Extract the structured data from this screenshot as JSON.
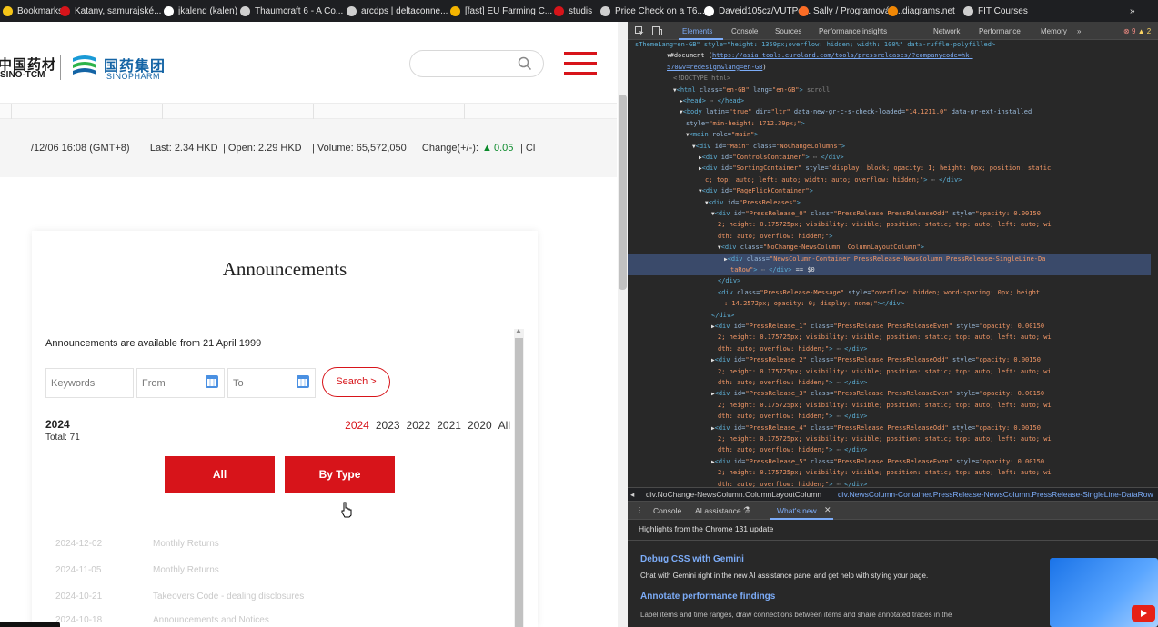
{
  "bookmarks": [
    {
      "label": "Bookmarks",
      "color": "#f5c518"
    },
    {
      "label": "Katany, samurajské...",
      "color": "#d7141a"
    },
    {
      "label": "jkalend (kalen)",
      "color": "#ffffff"
    },
    {
      "label": "Thaumcraft 6 - A Co...",
      "color": "#cfcfcf"
    },
    {
      "label": "arcdps | deltaconne...",
      "color": "#cfcfcf"
    },
    {
      "label": "[fast] EU Farming C...",
      "color": "#f4b400"
    },
    {
      "label": "studis",
      "color": "#d7141a"
    },
    {
      "label": "Price Check on a T6...",
      "color": "#cfcfcf"
    },
    {
      "label": "Daveid105cz/VUTPo...",
      "color": "#ffffff"
    },
    {
      "label": "Sally / Programován...",
      "color": "#fc6d26"
    },
    {
      "label": "diagrams.net",
      "color": "#f08705"
    },
    {
      "label": "FIT Courses",
      "color": "#cfcfcf"
    },
    {
      "label": "»",
      "color": ""
    }
  ],
  "header": {
    "logo_cn": "中国药材",
    "logo_en": "SINO-TCM",
    "sinopharm_cn": "国药集团",
    "sinopharm_en": "SINOPHARM"
  },
  "quote": {
    "date": "/12/06 16:08 (GMT+8)",
    "last": "| Last: 2.34 HKD",
    "open": "| Open: 2.29 HKD",
    "volume": "| Volume: 65,572,050",
    "change_label": "| Change(+/-):",
    "change_value": "0.05",
    "tail": "| Cl"
  },
  "announcements": {
    "title": "Announcements",
    "available": "Announcements are available from 21 April 1999",
    "keywords_placeholder": "Keywords",
    "from_placeholder": "From",
    "to_placeholder": "To",
    "search_label": "Search >",
    "selected_year": "2024",
    "total": "Total: 71",
    "years": [
      "2024",
      "2023",
      "2022",
      "2021",
      "2020",
      "All"
    ],
    "all_button": "All",
    "bytype_button": "By Type",
    "rows": [
      {
        "date": "2024-12-02",
        "title": "Monthly Returns"
      },
      {
        "date": "2024-11-05",
        "title": "Monthly Returns"
      },
      {
        "date": "2024-10-21",
        "title": "Takeovers Code - dealing disclosures"
      },
      {
        "date": "2024-10-18",
        "title": "Announcements and Notices"
      }
    ]
  },
  "devtools": {
    "tabs": [
      "Elements",
      "Console",
      "Sources",
      "Performance insights",
      "Network",
      "Performance",
      "Memory",
      "»"
    ],
    "errors": "9",
    "warnings": "2",
    "lines": [
      {
        "i": 0,
        "h": "",
        "frag": [
          [
            "tg",
            "sThemeLang=en-GB\" style=\"height: 1359px;overflow: hidden; width: 100%\" data-ruffle-polyfilled>"
          ]
        ]
      },
      {
        "i": 5,
        "h": "▼",
        "frag": [
          [
            "tx",
            "#document ("
          ],
          [
            "lk",
            "https://asia.tools.euroland.com/tools/pressreleases/?companycode=hk-"
          ]
        ]
      },
      {
        "i": 5,
        "h": "",
        "frag": [
          [
            "lk",
            "570&v=redesign&lang=en-GB"
          ],
          [
            "tx",
            ")"
          ]
        ]
      },
      {
        "i": 6,
        "h": "",
        "frag": [
          [
            "cm",
            "<!DOCTYPE html>"
          ]
        ]
      },
      {
        "i": 6,
        "h": "▼",
        "frag": [
          [
            "tg",
            "<html "
          ],
          [
            "at",
            "class="
          ],
          [
            "av",
            "\"en-GB\" "
          ],
          [
            "at",
            "lang="
          ],
          [
            "av",
            "\"en-GB\""
          ],
          [
            "tg",
            ">"
          ],
          [
            "cm",
            " scroll"
          ]
        ]
      },
      {
        "i": 7,
        "h": "▶",
        "frag": [
          [
            "tg",
            "<head>"
          ],
          [
            "cm",
            " ⋯ "
          ],
          [
            "tg",
            "</head>"
          ]
        ]
      },
      {
        "i": 7,
        "h": "▼",
        "frag": [
          [
            "tg",
            "<body "
          ],
          [
            "at",
            "latin="
          ],
          [
            "av",
            "\"true\" "
          ],
          [
            "at",
            "dir="
          ],
          [
            "av",
            "\"ltr\" "
          ],
          [
            "at",
            "data-new-gr-c-s-check-loaded="
          ],
          [
            "av",
            "\"14.1211.0\" "
          ],
          [
            "at",
            "data-gr-ext-installed"
          ]
        ]
      },
      {
        "i": 8,
        "h": "",
        "frag": [
          [
            "at",
            "style="
          ],
          [
            "av",
            "\"min-height: 1712.39px;\""
          ],
          [
            "tg",
            ">"
          ]
        ]
      },
      {
        "i": 8,
        "h": "▼",
        "frag": [
          [
            "tg",
            "<main "
          ],
          [
            "at",
            "role="
          ],
          [
            "av",
            "\"main\""
          ],
          [
            "tg",
            ">"
          ]
        ]
      },
      {
        "i": 9,
        "h": "▼",
        "frag": [
          [
            "tg",
            "<div "
          ],
          [
            "at",
            "id="
          ],
          [
            "av",
            "\"Main\" "
          ],
          [
            "at",
            "class="
          ],
          [
            "av",
            "\"NoChangeColumns\""
          ],
          [
            "tg",
            ">"
          ]
        ]
      },
      {
        "i": 10,
        "h": "▶",
        "frag": [
          [
            "tg",
            "<div "
          ],
          [
            "at",
            "id="
          ],
          [
            "av",
            "\"ControlsContainer\""
          ],
          [
            "tg",
            ">"
          ],
          [
            "cm",
            " ⋯ "
          ],
          [
            "tg",
            "</div>"
          ]
        ]
      },
      {
        "i": 10,
        "h": "▶",
        "frag": [
          [
            "tg",
            "<div "
          ],
          [
            "at",
            "id="
          ],
          [
            "av",
            "\"SortingContainer\" "
          ],
          [
            "at",
            "style="
          ],
          [
            "av",
            "\"display: block; opacity: 1; height: 0px; position: static"
          ]
        ]
      },
      {
        "i": 11,
        "h": "",
        "frag": [
          [
            "av",
            "c; top: auto; left: auto; width: auto; overflow: hidden;\""
          ],
          [
            "tg",
            ">"
          ],
          [
            "cm",
            " ⋯ "
          ],
          [
            "tg",
            "</div>"
          ]
        ]
      },
      {
        "i": 10,
        "h": "▼",
        "frag": [
          [
            "tg",
            "<div "
          ],
          [
            "at",
            "id="
          ],
          [
            "av",
            "\"PageFlickContainer\""
          ],
          [
            "tg",
            ">"
          ]
        ]
      },
      {
        "i": 11,
        "h": "▼",
        "frag": [
          [
            "tg",
            "<div "
          ],
          [
            "at",
            "id="
          ],
          [
            "av",
            "\"PressReleases\""
          ],
          [
            "tg",
            ">"
          ]
        ]
      },
      {
        "i": 12,
        "h": "▼",
        "frag": [
          [
            "tg",
            "<div "
          ],
          [
            "at",
            "id="
          ],
          [
            "av",
            "\"PressRelease_0\" "
          ],
          [
            "at",
            "class="
          ],
          [
            "av",
            "\"PressRelease PressReleaseOdd\" "
          ],
          [
            "at",
            "style="
          ],
          [
            "av",
            "\"opacity: 0.00150"
          ]
        ]
      },
      {
        "i": 13,
        "h": "",
        "frag": [
          [
            "av",
            "2; height: 0.175725px; visibility: visible; position: static; top: auto; left: auto; wi"
          ]
        ]
      },
      {
        "i": 13,
        "h": "",
        "frag": [
          [
            "av",
            "dth: auto; overflow: hidden;\""
          ],
          [
            "tg",
            ">"
          ]
        ]
      },
      {
        "i": 13,
        "h": "▼",
        "frag": [
          [
            "tg",
            "<div "
          ],
          [
            "at",
            "class="
          ],
          [
            "av",
            "\"NoChange-NewsColumn  ColumnLayoutColumn\""
          ],
          [
            "tg",
            ">"
          ]
        ]
      },
      {
        "i": 14,
        "h": "▶",
        "sel": true,
        "frag": [
          [
            "tg",
            "<div "
          ],
          [
            "at",
            "class="
          ],
          [
            "av",
            "\"NewsColumn-Container PressRelease-NewsColumn PressRelease-SingleLine-Da"
          ]
        ]
      },
      {
        "i": 15,
        "h": "",
        "sel": true,
        "frag": [
          [
            "av",
            "taRow\""
          ],
          [
            "tg",
            ">"
          ],
          [
            "cm",
            " ⋯ "
          ],
          [
            "tg",
            "</div>"
          ],
          [
            "tx",
            " == $0"
          ]
        ]
      },
      {
        "i": 13,
        "h": "",
        "frag": [
          [
            "tg",
            "</div>"
          ]
        ]
      },
      {
        "i": 13,
        "h": "",
        "frag": [
          [
            "tg",
            "<div "
          ],
          [
            "at",
            "class="
          ],
          [
            "av",
            "\"PressRelease-Message\" "
          ],
          [
            "at",
            "style="
          ],
          [
            "av",
            "\"overflow: hidden; word-spacing: 0px; height"
          ]
        ]
      },
      {
        "i": 14,
        "h": "",
        "frag": [
          [
            "av",
            ": 14.2572px; opacity: 0; display: none;\""
          ],
          [
            "tg",
            "></div>"
          ]
        ]
      },
      {
        "i": 12,
        "h": "",
        "frag": [
          [
            "tg",
            "</div>"
          ]
        ]
      },
      {
        "i": 12,
        "h": "▶",
        "frag": [
          [
            "tg",
            "<div "
          ],
          [
            "at",
            "id="
          ],
          [
            "av",
            "\"PressRelease_1\" "
          ],
          [
            "at",
            "class="
          ],
          [
            "av",
            "\"PressRelease PressReleaseEven\" "
          ],
          [
            "at",
            "style="
          ],
          [
            "av",
            "\"opacity: 0.00150"
          ]
        ]
      },
      {
        "i": 13,
        "h": "",
        "frag": [
          [
            "av",
            "2; height: 0.175725px; visibility: visible; position: static; top: auto; left: auto; wi"
          ]
        ]
      },
      {
        "i": 13,
        "h": "",
        "frag": [
          [
            "av",
            "dth: auto; overflow: hidden;\""
          ],
          [
            "tg",
            ">"
          ],
          [
            "cm",
            " ⋯ "
          ],
          [
            "tg",
            "</div>"
          ]
        ]
      },
      {
        "i": 12,
        "h": "▶",
        "frag": [
          [
            "tg",
            "<div "
          ],
          [
            "at",
            "id="
          ],
          [
            "av",
            "\"PressRelease_2\" "
          ],
          [
            "at",
            "class="
          ],
          [
            "av",
            "\"PressRelease PressReleaseOdd\" "
          ],
          [
            "at",
            "style="
          ],
          [
            "av",
            "\"opacity: 0.00150"
          ]
        ]
      },
      {
        "i": 13,
        "h": "",
        "frag": [
          [
            "av",
            "2; height: 0.175725px; visibility: visible; position: static; top: auto; left: auto; wi"
          ]
        ]
      },
      {
        "i": 13,
        "h": "",
        "frag": [
          [
            "av",
            "dth: auto; overflow: hidden;\""
          ],
          [
            "tg",
            ">"
          ],
          [
            "cm",
            " ⋯ "
          ],
          [
            "tg",
            "</div>"
          ]
        ]
      },
      {
        "i": 12,
        "h": "▶",
        "frag": [
          [
            "tg",
            "<div "
          ],
          [
            "at",
            "id="
          ],
          [
            "av",
            "\"PressRelease_3\" "
          ],
          [
            "at",
            "class="
          ],
          [
            "av",
            "\"PressRelease PressReleaseEven\" "
          ],
          [
            "at",
            "style="
          ],
          [
            "av",
            "\"opacity: 0.00150"
          ]
        ]
      },
      {
        "i": 13,
        "h": "",
        "frag": [
          [
            "av",
            "2; height: 0.175725px; visibility: visible; position: static; top: auto; left: auto; wi"
          ]
        ]
      },
      {
        "i": 13,
        "h": "",
        "frag": [
          [
            "av",
            "dth: auto; overflow: hidden;\""
          ],
          [
            "tg",
            ">"
          ],
          [
            "cm",
            " ⋯ "
          ],
          [
            "tg",
            "</div>"
          ]
        ]
      },
      {
        "i": 12,
        "h": "▶",
        "frag": [
          [
            "tg",
            "<div "
          ],
          [
            "at",
            "id="
          ],
          [
            "av",
            "\"PressRelease_4\" "
          ],
          [
            "at",
            "class="
          ],
          [
            "av",
            "\"PressRelease PressReleaseOdd\" "
          ],
          [
            "at",
            "style="
          ],
          [
            "av",
            "\"opacity: 0.00150"
          ]
        ]
      },
      {
        "i": 13,
        "h": "",
        "frag": [
          [
            "av",
            "2; height: 0.175725px; visibility: visible; position: static; top: auto; left: auto; wi"
          ]
        ]
      },
      {
        "i": 13,
        "h": "",
        "frag": [
          [
            "av",
            "dth: auto; overflow: hidden;\""
          ],
          [
            "tg",
            ">"
          ],
          [
            "cm",
            " ⋯ "
          ],
          [
            "tg",
            "</div>"
          ]
        ]
      },
      {
        "i": 12,
        "h": "▶",
        "frag": [
          [
            "tg",
            "<div "
          ],
          [
            "at",
            "id="
          ],
          [
            "av",
            "\"PressRelease_5\" "
          ],
          [
            "at",
            "class="
          ],
          [
            "av",
            "\"PressRelease PressReleaseEven\" "
          ],
          [
            "at",
            "style="
          ],
          [
            "av",
            "\"opacity: 0.00150"
          ]
        ]
      },
      {
        "i": 13,
        "h": "",
        "frag": [
          [
            "av",
            "2; height: 0.175725px; visibility: visible; position: static; top: auto; left: auto; wi"
          ]
        ]
      },
      {
        "i": 13,
        "h": "",
        "frag": [
          [
            "av",
            "dth: auto; overflow: hidden;\""
          ],
          [
            "tg",
            ">"
          ],
          [
            "cm",
            " ⋯ "
          ],
          [
            "tg",
            "</div>"
          ]
        ]
      }
    ],
    "breadcrumb": [
      "div.NoChange-NewsColumn.ColumnLayoutColumn",
      "div.NewsColumn-Container.PressRelease-NewsColumn.PressRelease-SingleLine-DataRow"
    ],
    "drawer_tabs": [
      "Console",
      "AI assistance",
      "What's new"
    ],
    "highlights": "Highlights from the Chrome 131 update",
    "item1_title": "Debug CSS with Gemini",
    "item1_text": "Chat with Gemini right in the new AI assistance panel and get help with styling your page.",
    "item2_title": "Annotate performance findings",
    "item2_text": "Label items and time ranges, draw connections between items and share annotated traces in the",
    "accent": "#7cacf8"
  }
}
